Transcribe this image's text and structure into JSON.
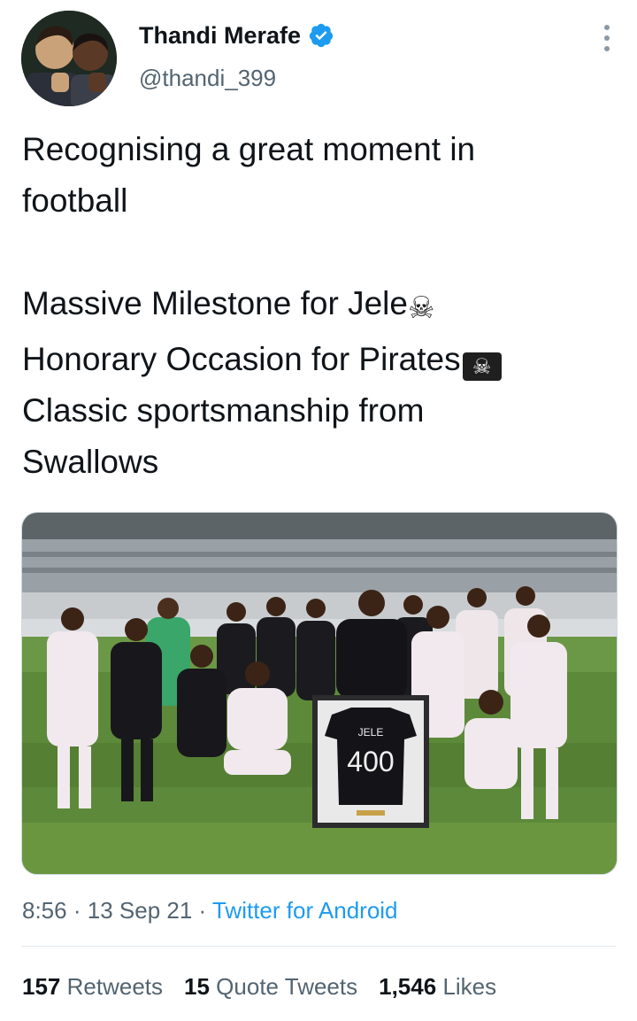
{
  "author": {
    "display_name": "Thandi Merafe",
    "handle": "@thandi_399",
    "verified_icon": "verified-badge-icon",
    "accent_color": "#1d9bf0"
  },
  "tweet": {
    "lines": [
      "Recognising a great moment in",
      "football",
      "",
      "Massive Milestone for Jele",
      "Honorary Occasion for Pirates",
      "Classic sportsmanship from",
      "Swallows"
    ],
    "emoji_skull": "☠",
    "emoji_pirate_flag": "☠"
  },
  "media": {
    "frame_jersey_name": "JELE",
    "frame_jersey_number": "400"
  },
  "meta": {
    "time": "8:56",
    "date": "13 Sep 21",
    "separator": "·",
    "source": "Twitter for Android"
  },
  "stats": {
    "retweets_count": "157",
    "retweets_label": "Retweets",
    "quotes_count": "15",
    "quotes_label": "Quote Tweets",
    "likes_count": "1,546",
    "likes_label": "Likes"
  }
}
